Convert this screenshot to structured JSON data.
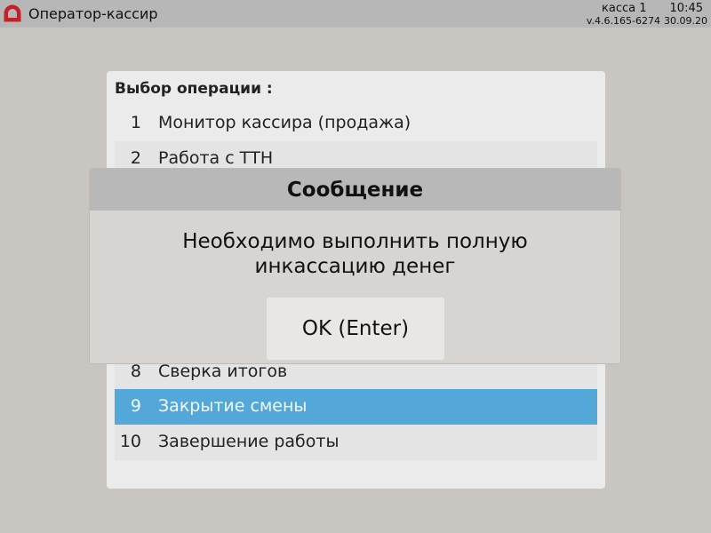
{
  "topbar": {
    "app_title": "Оператор-кассир",
    "register": "касса 1",
    "time": "10:45",
    "version": "v.4.6.165-6274",
    "date": "30.09.20",
    "logo_icon": "app-logo-icon",
    "accent_color": "#c5202a"
  },
  "panel": {
    "title": "Выбор операции :",
    "items": [
      {
        "num": "1",
        "label": "Монитор кассира (продажа)"
      },
      {
        "num": "2",
        "label": "Работа с ТТН"
      },
      {
        "num": "8",
        "label": "Сверка итогов"
      },
      {
        "num": "9",
        "label": "Закрытие смены",
        "selected": true
      },
      {
        "num": "10",
        "label": "Завершение работы"
      }
    ],
    "selected_color": "#54a8d9"
  },
  "dialog": {
    "title": "Сообщение",
    "message_line1": "Необходимо выполнить полную",
    "message_line2": "инкассацию денег",
    "ok_label": "OK (Enter)"
  }
}
